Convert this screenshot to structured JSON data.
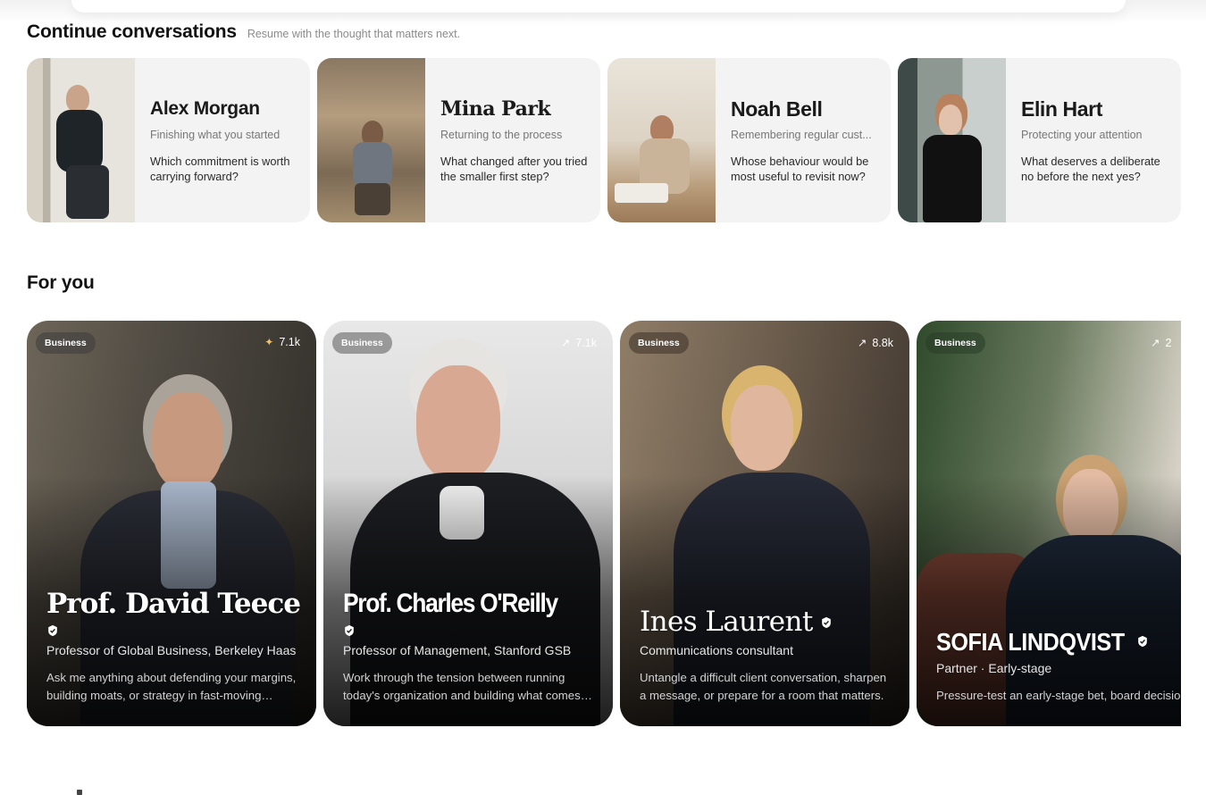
{
  "continue": {
    "title": "Continue conversations",
    "subtitle": "Resume with the thought that matters next.",
    "cards": [
      {
        "name": "Alex Morgan",
        "tagline": "Finishing what you started",
        "question": "Which commitment is worth carrying forward?"
      },
      {
        "name": "Mina Park",
        "tagline": "Returning to the process",
        "question": "What changed after you tried the smaller first step?"
      },
      {
        "name": "Noah Bell",
        "tagline": "Remembering regular cust...",
        "question": "Whose behaviour would be most useful to revisit now?"
      },
      {
        "name": "Elin Hart",
        "tagline": "Protecting your attention",
        "question": "What deserves a deliberate no before the next yes?"
      }
    ]
  },
  "for_you": {
    "title": "For you",
    "cards": [
      {
        "category": "Business",
        "stat": "7.1k",
        "stat_icon": "sparkle-icon",
        "name": "Prof. David Teece",
        "role": "Professor of Global Business, Berkeley Haas",
        "description": "Ask me anything about defending your margins, building moats, or strategy in fast-moving markets."
      },
      {
        "category": "Business",
        "stat": "7.1k",
        "stat_icon": "trending-up-icon",
        "name": "Prof. Charles O'Reilly",
        "role": "Professor of Management, Stanford GSB",
        "description": "Work through the tension between running today's organization and building what comes next."
      },
      {
        "category": "Business",
        "stat": "8.8k",
        "stat_icon": "trending-up-icon",
        "name": "Ines Laurent",
        "role": "Communications consultant",
        "description": "Untangle a difficult client conversation, sharpen a message, or prepare for a room that matters."
      },
      {
        "category": "Business",
        "stat": "2",
        "stat_icon": "trending-up-icon",
        "name": "SOFIA LINDQVIST",
        "role": "Partner · Early-stage",
        "description": "Pressure-test an early-stage bet, board decision, or fundraising story before the room."
      }
    ]
  }
}
